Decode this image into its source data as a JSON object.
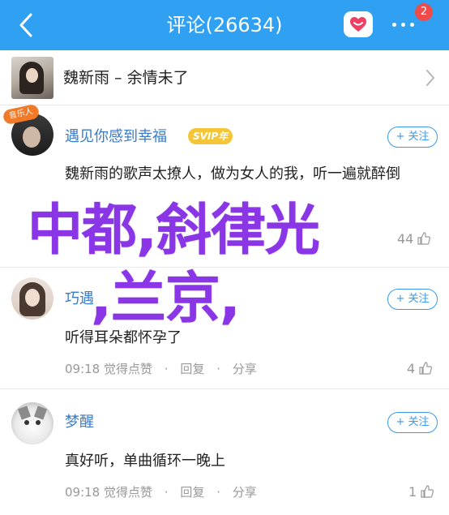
{
  "header": {
    "title": "评论(26634)",
    "notification_count": "2",
    "background": "#2fa0f2"
  },
  "song": {
    "title": "魏新雨 – 余情未了"
  },
  "comments": [
    {
      "username": "遇见你感到幸福",
      "badge": "SVIP年",
      "vip_tag": "音乐人",
      "follow_label": "+ 关注",
      "text": "魏新雨的歌声太撩人，做为女人的我，听一遍就醉倒",
      "time": "",
      "like_action": "",
      "reply_action": "",
      "share_action": "",
      "likes": "44"
    },
    {
      "username": "巧遇",
      "follow_label": "+ 关注",
      "text": "听得耳朵都怀孕了",
      "time": "09:18",
      "like_action": "觉得点赞",
      "reply_action": "回复",
      "share_action": "分享",
      "likes": "4"
    },
    {
      "username": "梦醒",
      "follow_label": "+ 关注",
      "text": "真好听，单曲循环一晚上",
      "time": "09:18",
      "like_action": "觉得点赞",
      "reply_action": "回复",
      "share_action": "分享",
      "likes": "1"
    }
  ],
  "watermark": {
    "line1": "中都,斜律光",
    "line2": ",兰京,",
    "color": "#8a35e6"
  },
  "icons": {
    "back": "chevron-left-icon",
    "favorite": "heart-icon",
    "more": "more-dots-icon",
    "like": "thumb-up-icon",
    "chevron": "chevron-right-icon"
  }
}
